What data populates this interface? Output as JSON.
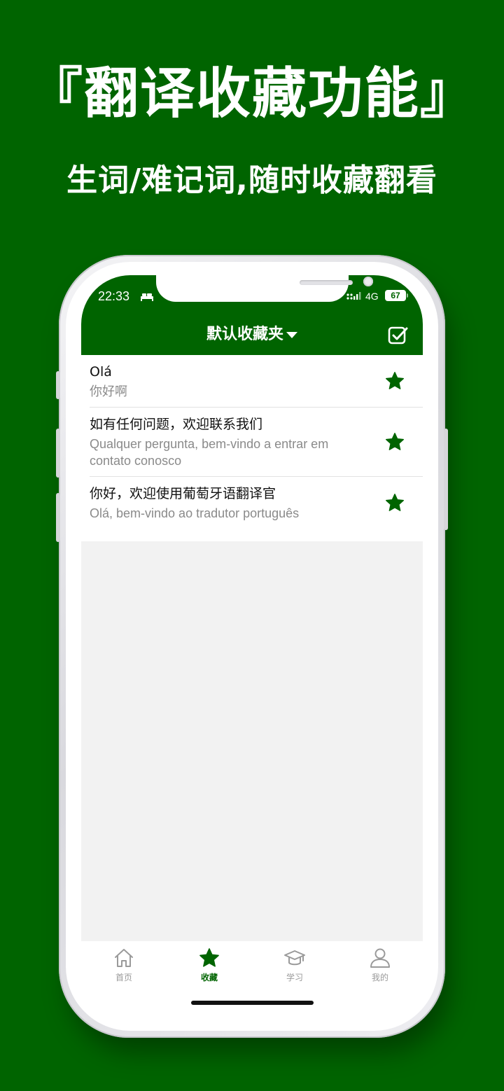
{
  "promo": {
    "title": "『翻译收藏功能』",
    "subtitle": "生词/难记词,随时收藏翻看"
  },
  "status_bar": {
    "time": "22:33",
    "network": "4G",
    "battery": "67",
    "icons": [
      "bed-icon",
      "signal-icon",
      "battery-icon"
    ]
  },
  "nav": {
    "title": "默认收藏夹",
    "title_icon": "caret-down-icon",
    "action_icon": "checkbox-icon"
  },
  "favorites": {
    "items": [
      {
        "primary": "Olá",
        "secondary": "你好啊"
      },
      {
        "primary": "如有任何问题，欢迎联系我们",
        "secondary": "Qualquer pergunta, bem-vindo a entrar em contato conosco"
      },
      {
        "primary": "你好，欢迎使用葡萄牙语翻译官",
        "secondary": "Olá, bem-vindo ao tradutor português"
      }
    ],
    "star_icon": "star-icon"
  },
  "tabs": [
    {
      "label": "首页",
      "icon": "home-icon"
    },
    {
      "label": "收藏",
      "icon": "star-icon",
      "active": true
    },
    {
      "label": "学习",
      "icon": "graduation-cap-icon"
    },
    {
      "label": "我的",
      "icon": "user-icon"
    }
  ],
  "colors": {
    "brand": "#006400",
    "inactive": "#9a9a9a",
    "text_primary": "#111111",
    "text_secondary": "#8a8a8a",
    "empty_background": "#f2f2f2"
  }
}
